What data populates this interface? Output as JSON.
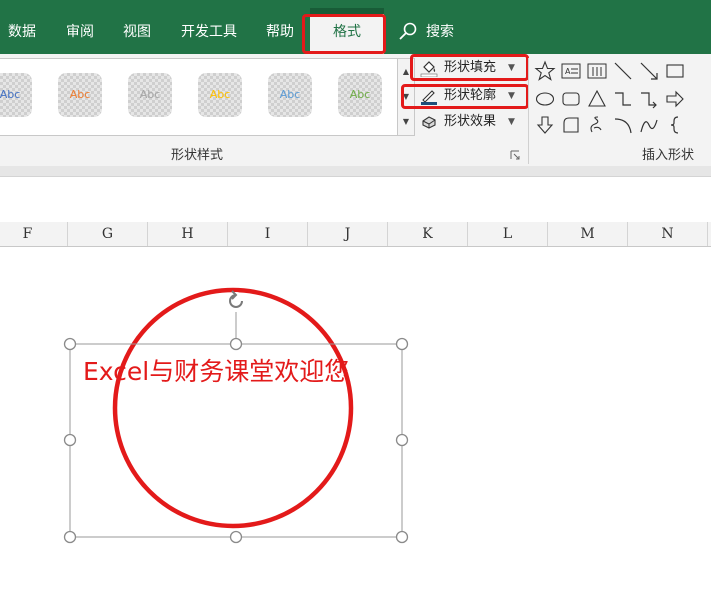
{
  "ribbon_tabs": [
    {
      "label": "数据"
    },
    {
      "label": "审阅"
    },
    {
      "label": "视图"
    },
    {
      "label": "开发工具"
    },
    {
      "label": "帮助"
    }
  ],
  "active_tab": {
    "label": "格式"
  },
  "search": {
    "label": "搜索"
  },
  "shape_styles": {
    "swatches": [
      {
        "text": "Abc",
        "color": "#4472c4"
      },
      {
        "text": "Abc",
        "color": "#ed7d31"
      },
      {
        "text": "Abc",
        "color": "#a5a5a5"
      },
      {
        "text": "Abc",
        "color": "#ffc000"
      },
      {
        "text": "Abc",
        "color": "#5b9bd5"
      },
      {
        "text": "Abc",
        "color": "#70ad47"
      }
    ],
    "fill_label": "形状填充",
    "outline_label": "形状轮廓",
    "effects_label": "形状效果",
    "group_label": "形状样式"
  },
  "insert_shapes": {
    "group_label": "插入形状",
    "icons": [
      "star-icon",
      "textbox-icon",
      "vertical-textbox-icon",
      "line-icon",
      "arrow-line-icon",
      "rectangle-icon",
      "oval-icon",
      "rounded-rect-icon",
      "triangle-icon",
      "elbow-connector-icon",
      "elbow-arrow-icon",
      "right-arrow-icon",
      "down-arrow-icon",
      "folded-corner-icon",
      "scribble-icon",
      "arc-icon",
      "curve-icon",
      "brace-icon"
    ]
  },
  "columns": [
    "F",
    "G",
    "H",
    "I",
    "J",
    "K",
    "L",
    "M",
    "N"
  ],
  "textbox": {
    "text": "Excel与财务课堂欢迎您"
  },
  "colors": {
    "ribbon_green": "#217346",
    "highlight_red": "#e31a1a",
    "circle_outline": "#e31a1a"
  }
}
